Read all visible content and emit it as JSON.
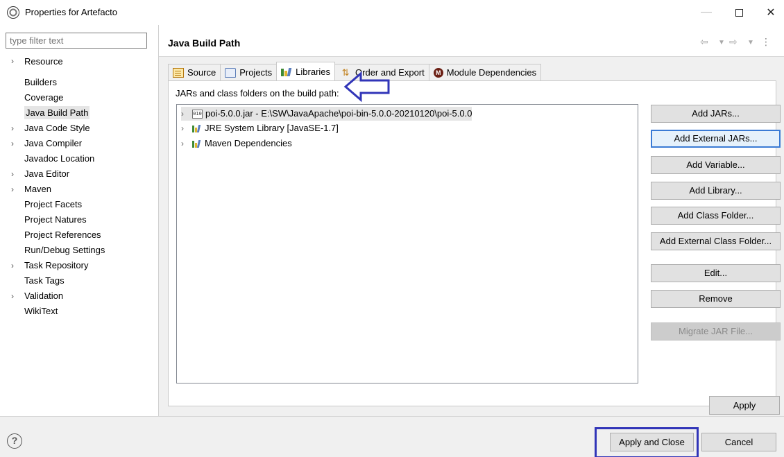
{
  "window": {
    "title": "Properties for Artefacto",
    "minimize": "—",
    "close": "✕"
  },
  "nav": {
    "filter_placeholder": "type filter text",
    "items": [
      {
        "label": "Resource",
        "expandable": true
      },
      {
        "label": "Builders",
        "expandable": false
      },
      {
        "label": "Coverage",
        "expandable": false
      },
      {
        "label": "Java Build Path",
        "expandable": false,
        "selected": true
      },
      {
        "label": "Java Code Style",
        "expandable": true
      },
      {
        "label": "Java Compiler",
        "expandable": true
      },
      {
        "label": "Javadoc Location",
        "expandable": false
      },
      {
        "label": "Java Editor",
        "expandable": true
      },
      {
        "label": "Maven",
        "expandable": true
      },
      {
        "label": "Project Facets",
        "expandable": false
      },
      {
        "label": "Project Natures",
        "expandable": false
      },
      {
        "label": "Project References",
        "expandable": false
      },
      {
        "label": "Run/Debug Settings",
        "expandable": false
      },
      {
        "label": "Task Repository",
        "expandable": true
      },
      {
        "label": "Task Tags",
        "expandable": false
      },
      {
        "label": "Validation",
        "expandable": true
      },
      {
        "label": "WikiText",
        "expandable": false
      }
    ]
  },
  "page": {
    "title": "Java Build Path",
    "history": {
      "back": "⇦",
      "forward": "⇨",
      "menu": "▼",
      "more": "⋮"
    }
  },
  "tabs": [
    {
      "label": "Source",
      "icon": "source-icon"
    },
    {
      "label": "Projects",
      "icon": "folder-icon"
    },
    {
      "label": "Libraries",
      "icon": "library-icon",
      "active": true
    },
    {
      "label": "Order and Export",
      "icon": "order-export-icon"
    },
    {
      "label": "Module Dependencies",
      "icon": "module-icon"
    }
  ],
  "libraries": {
    "label": "JARs and class folders on the build path:",
    "entries": [
      {
        "label": "poi-5.0.0.jar - E:\\SW\\JavaApache\\poi-bin-5.0.0-20210120\\poi-5.0.0",
        "icon": "jar-icon",
        "jar_glyph": "010",
        "selected": true
      },
      {
        "label": "JRE System Library [JavaSE-1.7]",
        "icon": "library-icon"
      },
      {
        "label": "Maven Dependencies",
        "icon": "library-icon"
      }
    ],
    "buttons": [
      {
        "label": "Add JARs...",
        "state": "normal"
      },
      {
        "label": "Add External JARs...",
        "state": "focused"
      },
      {
        "label": "Add Variable...",
        "state": "normal"
      },
      {
        "label": "Add Library...",
        "state": "normal"
      },
      {
        "label": "Add Class Folder...",
        "state": "normal"
      },
      {
        "label": "Add External Class Folder...",
        "state": "normal"
      },
      {
        "label": "Edit...",
        "state": "normal"
      },
      {
        "label": "Remove",
        "state": "normal"
      },
      {
        "label": "Migrate JAR File...",
        "state": "disabled"
      }
    ]
  },
  "apply_label": "Apply",
  "footer": {
    "help": "?",
    "apply_close": "Apply and Close",
    "cancel": "Cancel"
  },
  "colors": {
    "annotation": "#3135b8",
    "focus": "#3a7bd5",
    "selection": "#e5e5e5"
  }
}
